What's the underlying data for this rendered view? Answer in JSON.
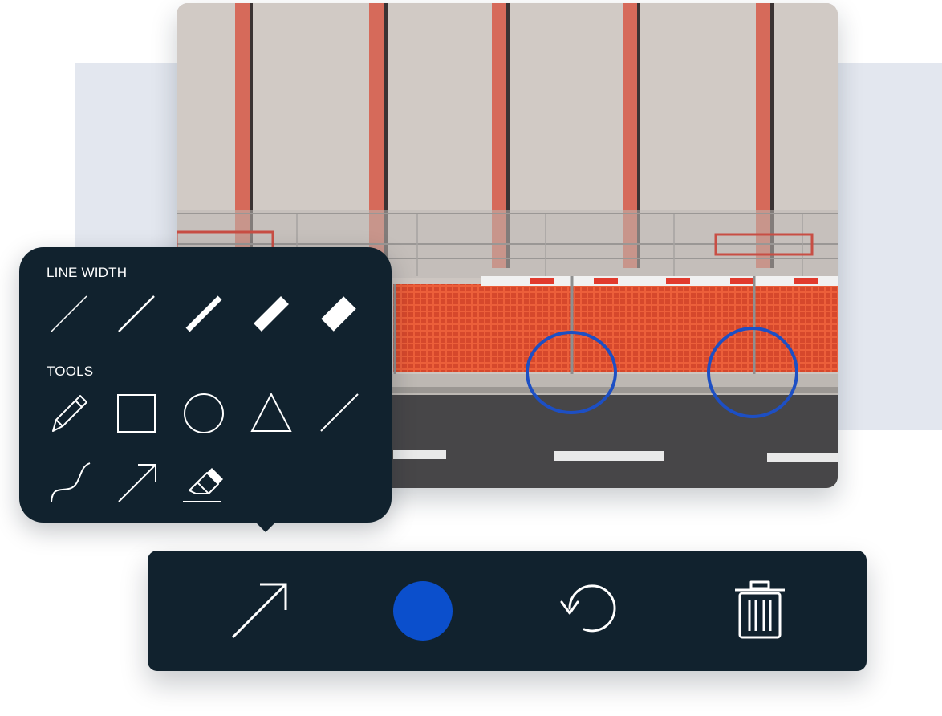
{
  "annotation_panel": {
    "line_width_label": "LINE WIDTH",
    "tools_label": "TOOLS",
    "line_widths": [
      {
        "icon": "line-width-1-icon",
        "level": 1
      },
      {
        "icon": "line-width-2-icon",
        "level": 2
      },
      {
        "icon": "line-width-3-icon",
        "level": 3
      },
      {
        "icon": "line-width-4-icon",
        "level": 4
      },
      {
        "icon": "line-width-5-icon",
        "level": 5
      }
    ],
    "tools": [
      {
        "icon": "pencil-icon"
      },
      {
        "icon": "rectangle-icon"
      },
      {
        "icon": "circle-icon"
      },
      {
        "icon": "triangle-icon"
      },
      {
        "icon": "line-icon"
      },
      {
        "icon": "curve-icon"
      },
      {
        "icon": "arrow-icon"
      },
      {
        "icon": "eraser-icon"
      }
    ]
  },
  "toolbar": {
    "buttons": [
      {
        "icon": "arrow-tool-icon"
      },
      {
        "icon": "color-swatch",
        "color": "#0b4fcc"
      },
      {
        "icon": "undo-icon"
      },
      {
        "icon": "trash-icon"
      }
    ]
  },
  "photo": {
    "annotation_color": "#1d4fc4",
    "annotations": [
      "circle",
      "circle"
    ]
  },
  "colors": {
    "panel_bg": "#11222e",
    "backdrop": "#e3e7ef",
    "accent_blue": "#0b4fcc"
  }
}
